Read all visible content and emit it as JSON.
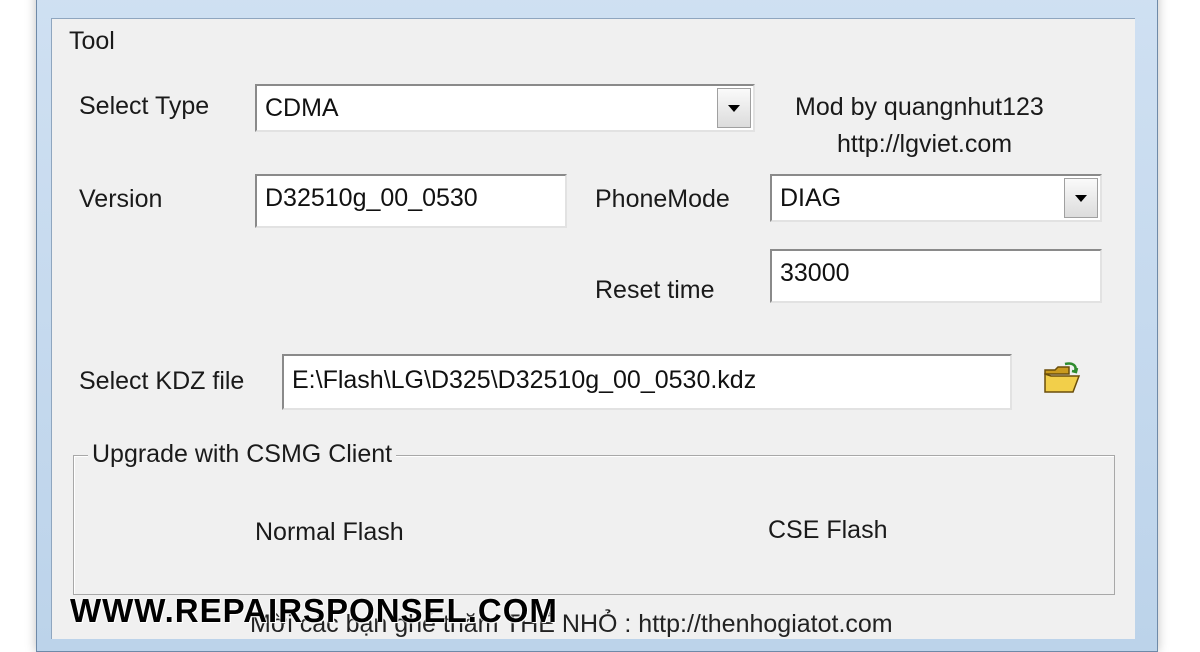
{
  "menu": {
    "tool": "Tool"
  },
  "credits": {
    "mod_by": "Mod by quangnhut123",
    "site": "http://lgviet.com"
  },
  "select_type": {
    "label": "Select Type",
    "value": "CDMA"
  },
  "version": {
    "label": "Version",
    "value": "D32510g_00_0530"
  },
  "phone_mode": {
    "label": "PhoneMode",
    "value": "DIAG"
  },
  "reset_time": {
    "label": "Reset time",
    "value": "33000"
  },
  "kdz": {
    "label": "Select KDZ file",
    "value": "E:\\Flash\\LG\\D325\\D32510g_00_0530.kdz",
    "icon": "folder-open-icon"
  },
  "upgrade_group": {
    "title": "Upgrade with CSMG Client",
    "normal_flash": "Normal Flash",
    "cse_flash": "CSE Flash"
  },
  "bottom_text": "Mời các bạn ghé thăm THẾ NHỎ : http://thenhogiatot.com",
  "watermark": "WWW.REPAIRSPONSEL.COM",
  "colors": {
    "client_bg": "#f0f0f0",
    "frame": "#bcd3ea",
    "title_icon": "#c0306a"
  }
}
